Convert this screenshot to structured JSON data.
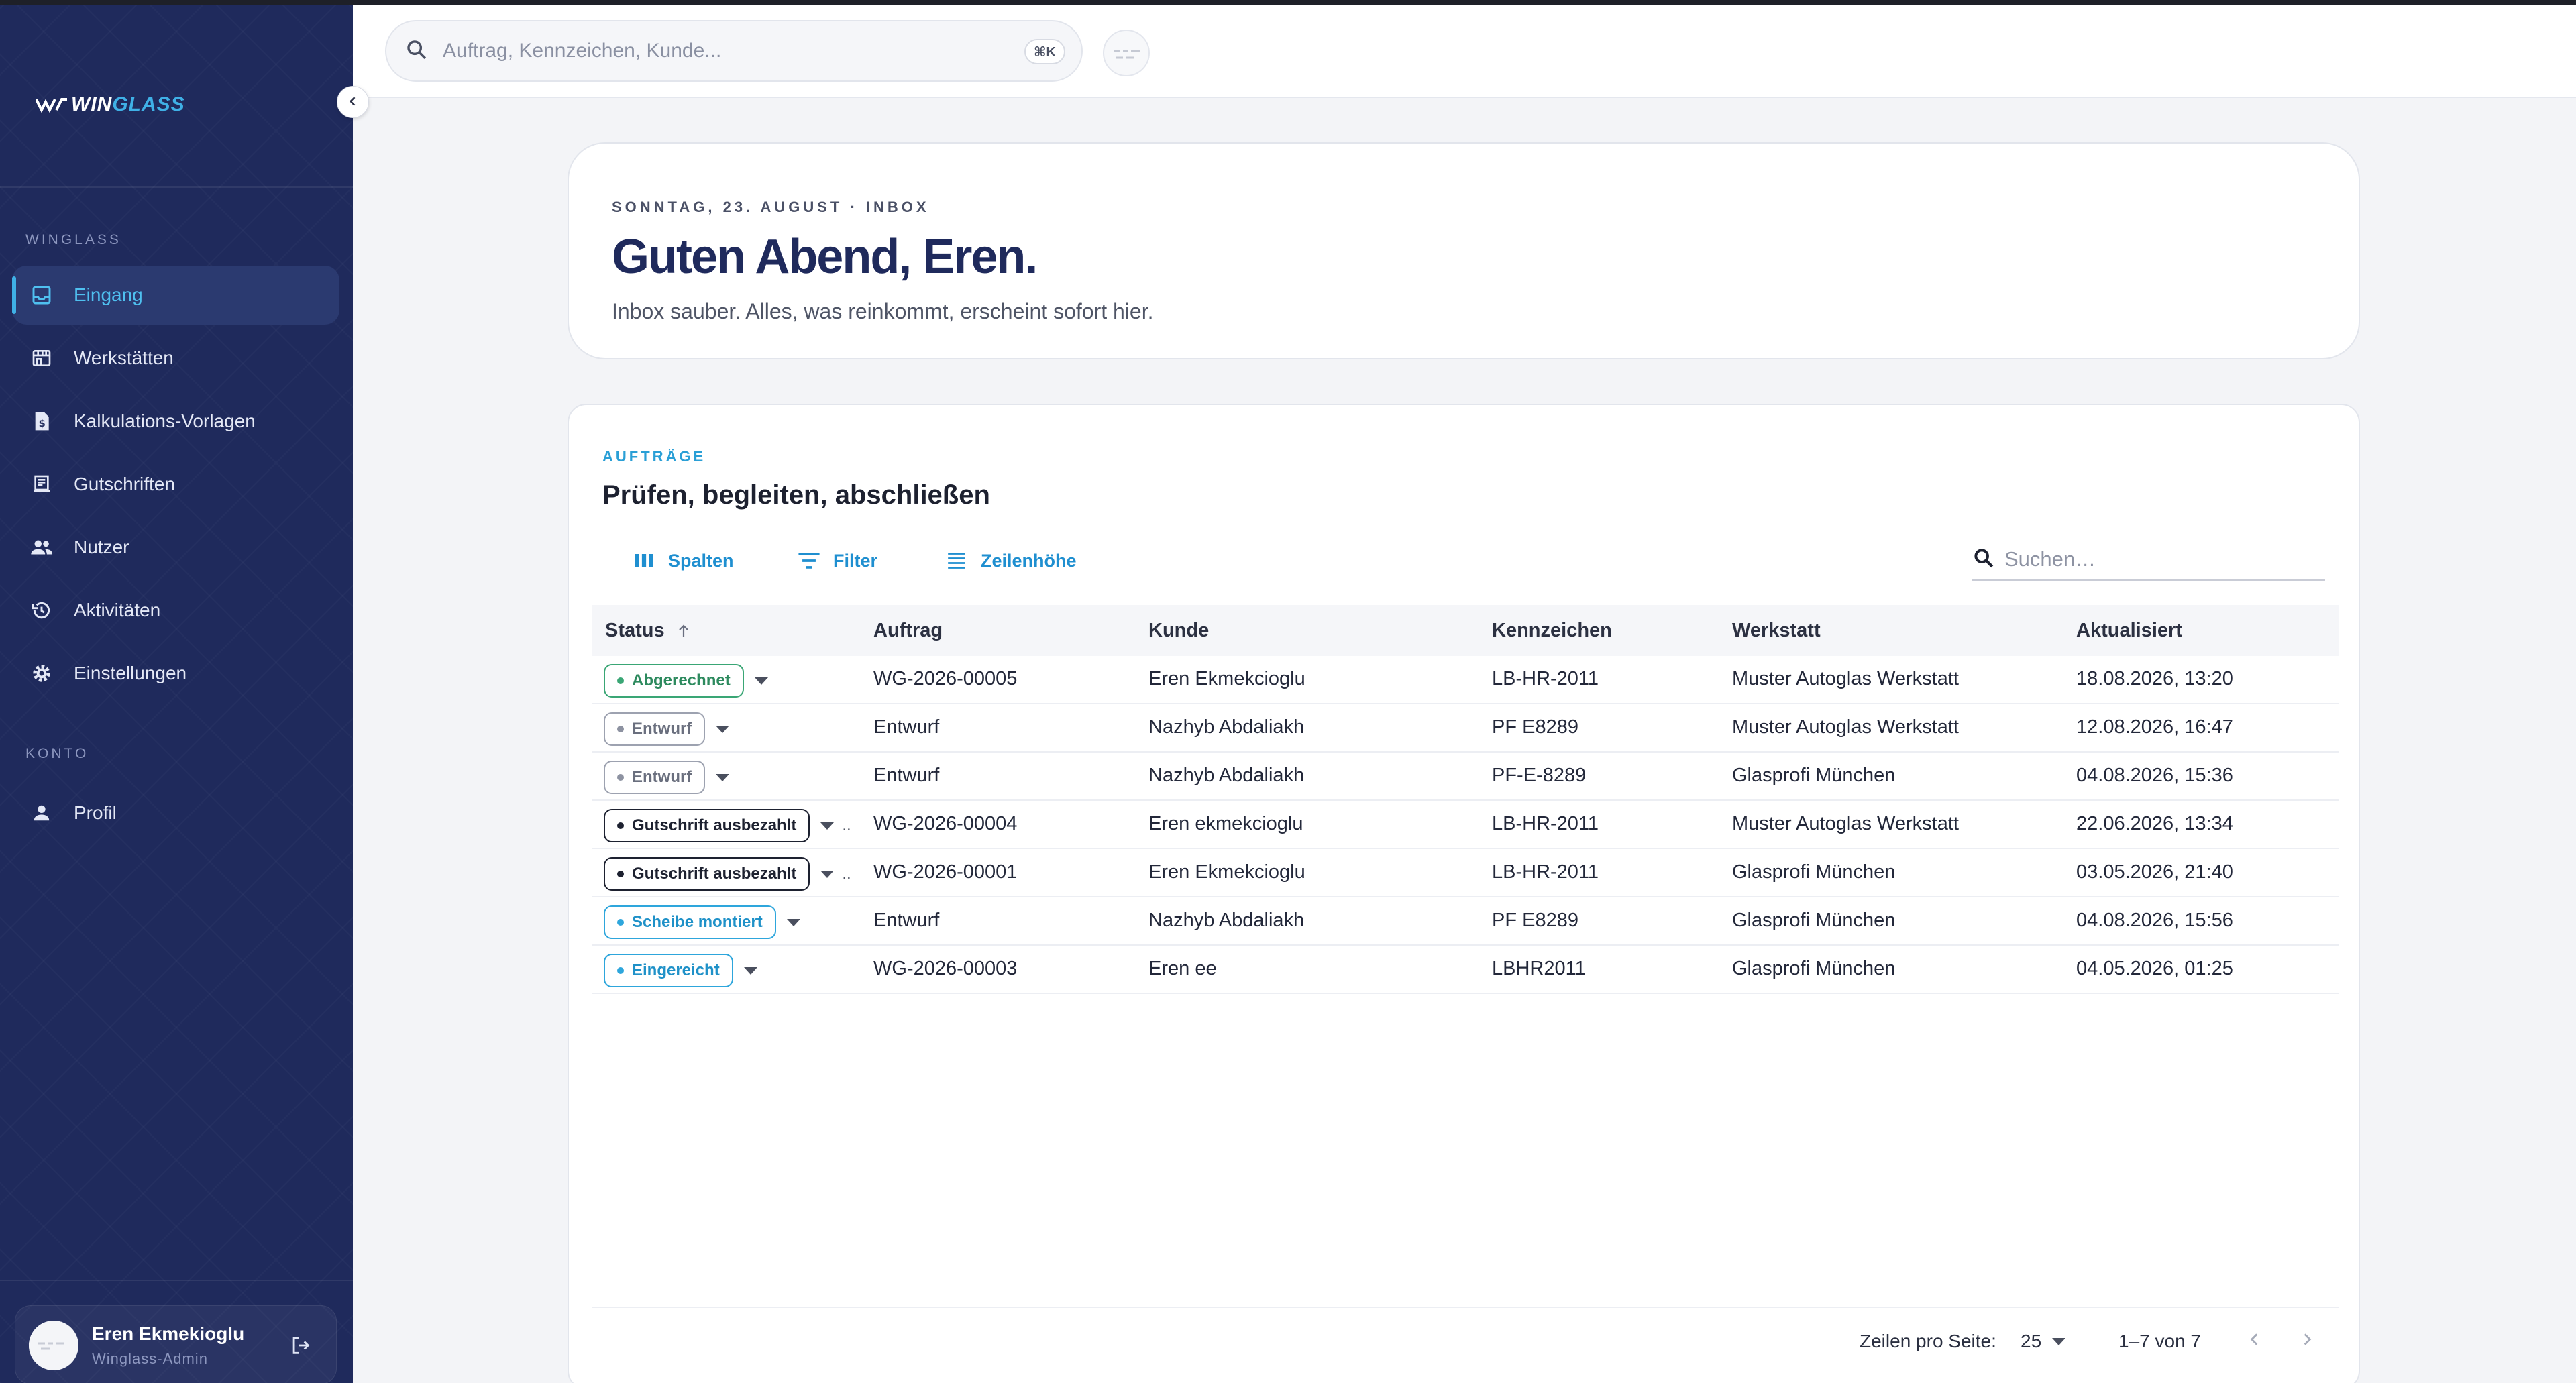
{
  "brand": {
    "logo_main": "WIN",
    "logo_accent": "GLASS"
  },
  "sidebar": {
    "section_main": "WINGLASS",
    "section_account": "KONTO",
    "items": [
      {
        "label": "Eingang",
        "icon": "inbox-icon"
      },
      {
        "label": "Werkstätten",
        "icon": "store-icon"
      },
      {
        "label": "Kalkulations-Vorlagen",
        "icon": "price-doc-icon"
      },
      {
        "label": "Gutschriften",
        "icon": "receipt-icon"
      },
      {
        "label": "Nutzer",
        "icon": "users-icon"
      },
      {
        "label": "Aktivitäten",
        "icon": "history-icon"
      },
      {
        "label": "Einstellungen",
        "icon": "gear-icon"
      }
    ],
    "account_items": [
      {
        "label": "Profil",
        "icon": "person-icon"
      }
    ],
    "user": {
      "name": "Eren Ekmekioglu",
      "role": "Winglass-Admin"
    }
  },
  "topbar": {
    "search_placeholder": "Auftrag, Kennzeichen, Kunde...",
    "shortcut": "⌘K"
  },
  "hero": {
    "date_line": "SONNTAG, 23. AUGUST · INBOX",
    "title": "Guten Abend, Eren.",
    "subtitle": "Inbox sauber. Alles, was reinkommt, erscheint sofort hier."
  },
  "orders": {
    "eyebrow": "AUFTRÄGE",
    "title": "Prüfen, begleiten, abschließen",
    "toolbar": {
      "columns": "Spalten",
      "filter": "Filter",
      "density": "Zeilenhöhe"
    },
    "search_placeholder": "Suchen…",
    "columns": [
      "Status",
      "Auftrag",
      "Kunde",
      "Kennzeichen",
      "Werkstatt",
      "Aktualisiert"
    ],
    "rows": [
      {
        "status": "Abgerechnet",
        "tone": "green",
        "order": "WG-2026-00005",
        "customer": "Eren Ekmekcioglu",
        "plate": "LB-HR-2011",
        "workshop": "Muster Autoglas Werkstatt",
        "updated": "18.08.2026, 13:20"
      },
      {
        "status": "Entwurf",
        "tone": "gray",
        "order": "Entwurf",
        "customer": "Nazhyb Abdaliakh",
        "plate": "PF E8289",
        "workshop": "Muster Autoglas Werkstatt",
        "updated": "12.08.2026, 16:47"
      },
      {
        "status": "Entwurf",
        "tone": "gray",
        "order": "Entwurf",
        "customer": "Nazhyb Abdaliakh",
        "plate": "PF-E-8289",
        "workshop": "Glasprofi München",
        "updated": "04.08.2026, 15:36"
      },
      {
        "status": "Gutschrift ausbezahlt",
        "tone": "dark",
        "order": "WG-2026-00004",
        "customer": "Eren ekmekcioglu",
        "plate": "LB-HR-2011",
        "workshop": "Muster Autoglas Werkstatt",
        "updated": "22.06.2026, 13:34"
      },
      {
        "status": "Gutschrift ausbezahlt",
        "tone": "dark",
        "order": "WG-2026-00001",
        "customer": "Eren Ekmekcioglu",
        "plate": "LB-HR-2011",
        "workshop": "Glasprofi München",
        "updated": "03.05.2026, 21:40"
      },
      {
        "status": "Scheibe montiert",
        "tone": "blue",
        "order": "Entwurf",
        "customer": "Nazhyb Abdaliakh",
        "plate": "PF E8289",
        "workshop": "Glasprofi München",
        "updated": "04.08.2026, 15:56"
      },
      {
        "status": "Eingereicht",
        "tone": "blue",
        "order": "WG-2026-00003",
        "customer": "Eren ee",
        "plate": "LBHR2011",
        "workshop": "Glasprofi München",
        "updated": "04.05.2026, 01:25"
      }
    ],
    "pagination": {
      "rows_per_page_label": "Zeilen pro Seite:",
      "rows_per_page": "25",
      "range": "1–7 von 7"
    }
  },
  "colors": {
    "sidebar_bg": "#1f2a5c",
    "accent": "#3fb0e6",
    "title": "#1f2a5c"
  }
}
